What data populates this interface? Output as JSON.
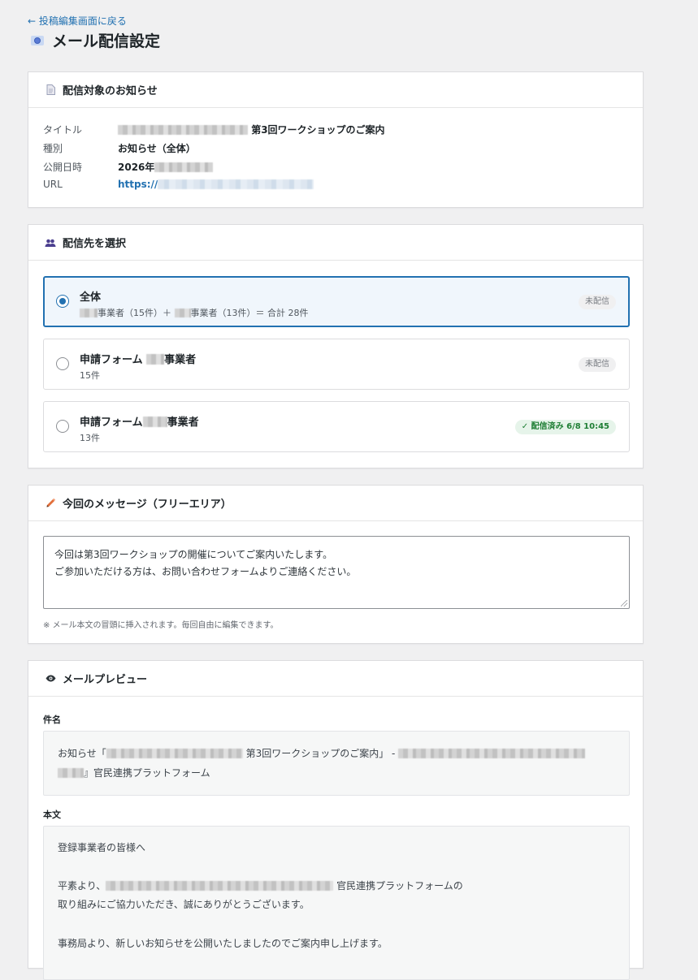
{
  "header": {
    "back_link": "← 投稿編集画面に戻る",
    "title": "メール配信設定",
    "title_icon": "envelope-icon"
  },
  "notice_card": {
    "title": "配信対象のお知らせ",
    "icon": "document-icon",
    "rows": [
      {
        "label": "タイトル",
        "value": "第3回ワークショップのご案内"
      },
      {
        "label": "種別",
        "value": "お知らせ（全体）"
      },
      {
        "label": "公開日時",
        "value": "2026年"
      },
      {
        "label": "URL",
        "value": "https://"
      }
    ]
  },
  "recipients_card": {
    "title": "配信先を選択",
    "icon": "users-icon",
    "options": [
      {
        "title": "全体",
        "sub_a": "事業者（15件）＋",
        "sub_b": "事業者（13件）＝ 合計 28件",
        "status": "未配信",
        "selected": true
      },
      {
        "title_a": "申請フォーム",
        "title_b": "事業者",
        "sub": "15件",
        "status": "未配信",
        "selected": false
      },
      {
        "title_a": "申請フォーム",
        "title_b": "事業者",
        "sub": "13件",
        "status": "✓ 配信済み 6/8 10:45",
        "selected": false
      }
    ]
  },
  "message_card": {
    "title": "今回のメッセージ（フリーエリア）",
    "icon": "pencil-icon",
    "lines": [
      "今回は第3回ワークショップの開催についてご案内いたします。",
      "ご参加いただける方は、お問い合わせフォームよりご連絡ください。"
    ],
    "note": "※ メール本文の冒頭に挿入されます。毎回自由に編集できます。"
  },
  "preview_card": {
    "title": "メールプレビュー",
    "icon": "eye-icon",
    "subject_label": "件名",
    "subject_line1_a": "お知らせ「",
    "subject_line1_b": "第3回ワークショップのご案内」 -",
    "subject_line2": "』官民連携プラットフォーム",
    "body_label": "本文",
    "body_line1": "登録事業者の皆様へ",
    "body_line2_a": "平素より、",
    "body_line2_b": "官民連携プラットフォームの",
    "body_line3": "取り組みにご協力いただき、誠にありがとうございます。",
    "body_line4": "事務局より、新しいお知らせを公開いたしましたのでご案内申し上げます。"
  },
  "colors": {
    "accent": "#2271b1",
    "done_badge_bg": "#e6f4ea",
    "done_badge_text": "#1e7e34",
    "pencil": "#e26f3a",
    "users": "#4b3f8f"
  }
}
